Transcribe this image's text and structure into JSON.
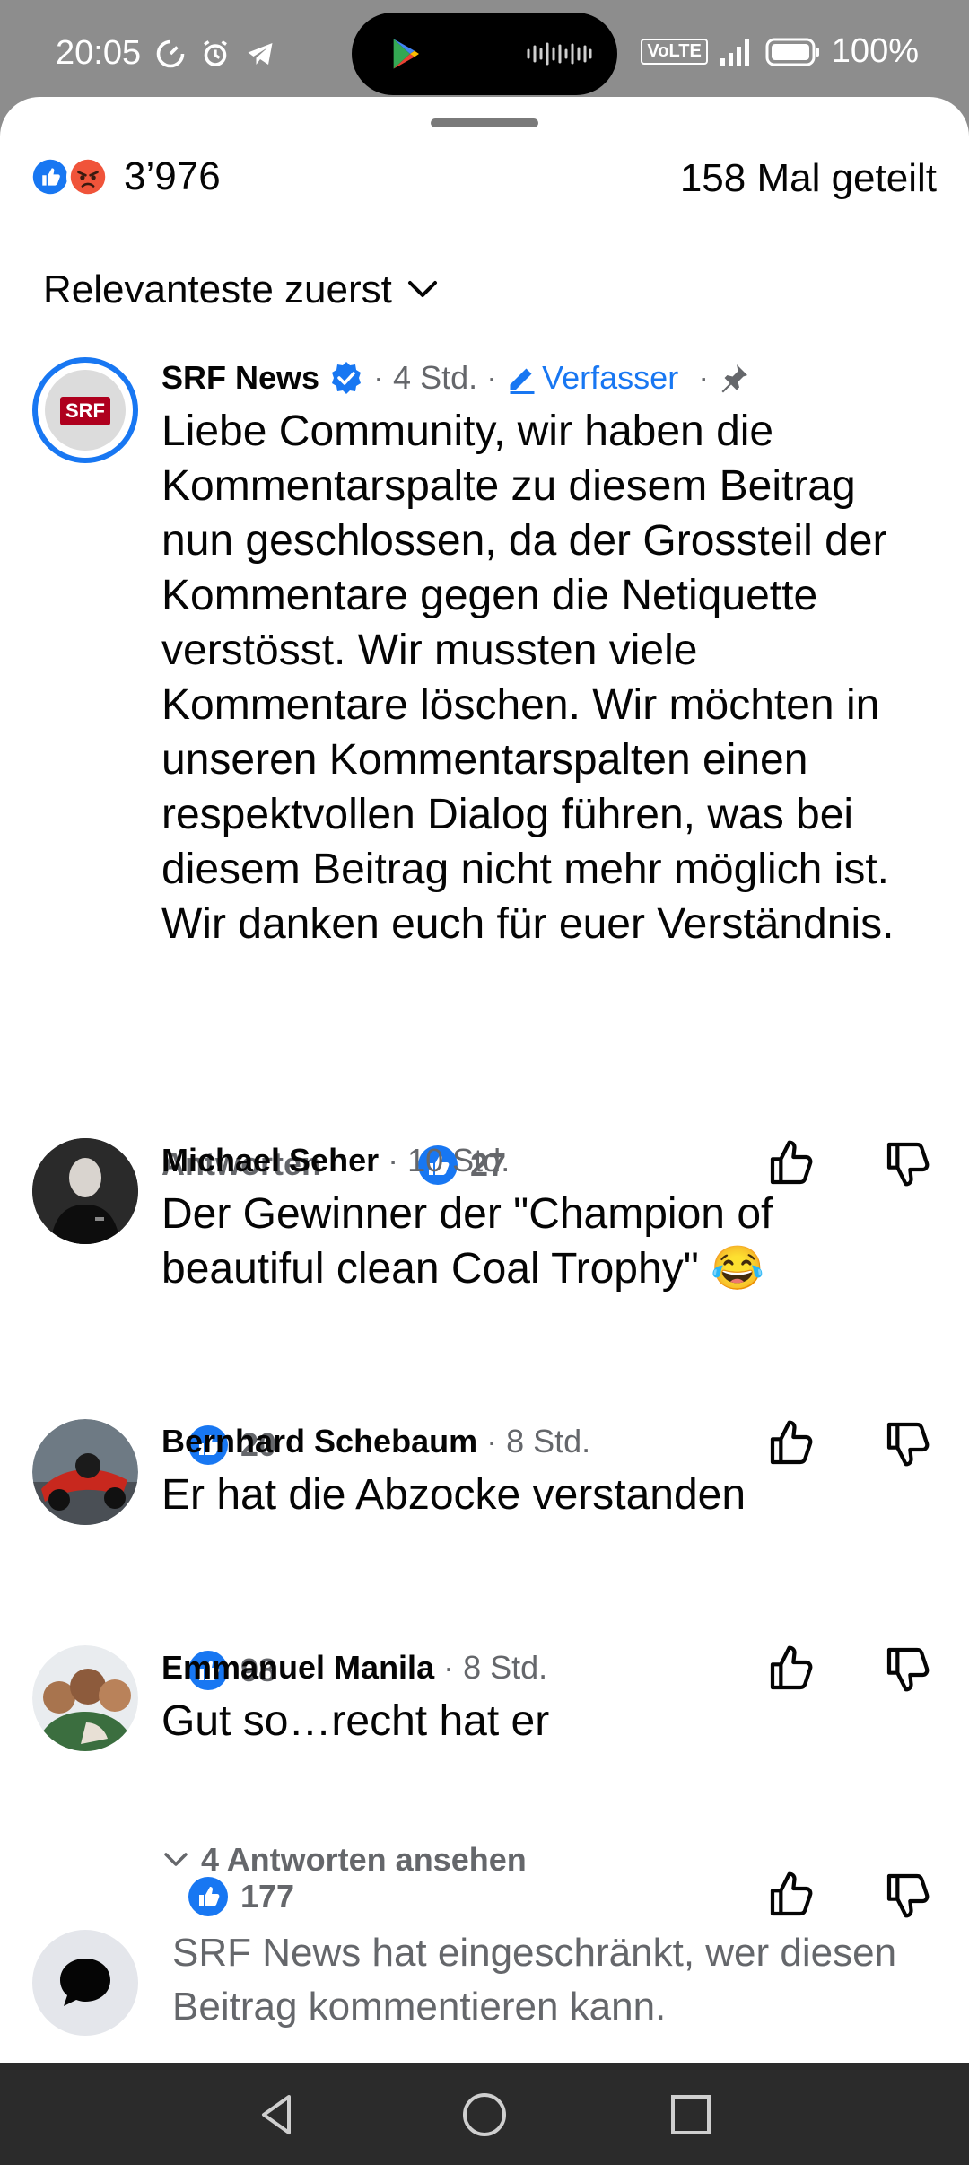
{
  "status_bar": {
    "time": "20:05",
    "volte": "VoLTE",
    "battery": "100%"
  },
  "header": {
    "reactions_count": "3’976",
    "share_count": "158 Mal geteilt"
  },
  "sort": {
    "label": "Relevanteste zuerst"
  },
  "comments": [
    {
      "author": "SRF News",
      "avatar_label": "SRF",
      "time": "4 Std.",
      "author_badge": "Verfasser",
      "text": "Liebe Community, wir haben die Kommentarspalte zu diesem Beitrag nun geschlossen, da der Grossteil der Kommentare gegen die Netiquette verstösst. Wir mussten viele Kommentare löschen. Wir möchten in unseren Kommentarspalten einen respektvollen Dialog führen, was bei diesem Beitrag nicht mehr möglich ist. Wir danken euch für euer Verständnis.",
      "reply_label": "Antworten",
      "likes": "27"
    },
    {
      "author": "Michael Seher",
      "time": "10 Std.",
      "text": "Der Gewinner der \"Champion of beautiful clean Coal Trophy\" 😂",
      "likes": "20"
    },
    {
      "author": "Bernhard Schebaum",
      "time": "8 Std.",
      "text": "Er hat die Abzocke verstanden",
      "likes": "98"
    },
    {
      "author": "Emmanuel Manila",
      "time": "8 Std.",
      "text": "Gut so…recht hat er",
      "likes": "177"
    }
  ],
  "view_replies": "4 Antworten ansehen",
  "restricted": {
    "name": "SRF News",
    "text": " hat eingeschränkt, wer diesen Beitrag kommentieren kann."
  },
  "colors": {
    "facebook_blue": "#1877f2",
    "angry_orange": "#f0543a",
    "srf_red": "#af001e",
    "secondary_text": "#65676b"
  }
}
